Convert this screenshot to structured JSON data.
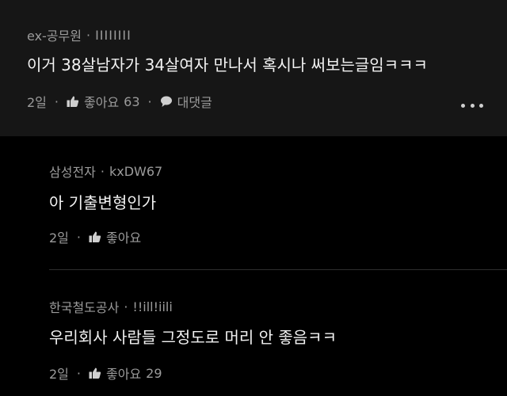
{
  "comments": [
    {
      "author": "ex-공무원",
      "handle": "IIIIIIII",
      "text": "이거 38살남자가 34살여자 만나서 혹시나 써보는글임ㅋㅋㅋ",
      "time": "2일",
      "like_label": "좋아요",
      "like_count": "63",
      "reply_label": "대댓글"
    }
  ],
  "replies": [
    {
      "author": "삼성전자",
      "handle": "kxDW67",
      "text": "아 기출변형인가",
      "time": "2일",
      "like_label": "좋아요"
    },
    {
      "author": "한국철도공사",
      "handle": "!!ill!iili",
      "text": "우리회사 사람들 그정도로 머리 안 좋음ㅋㅋ",
      "time": "2일",
      "like_label": "좋아요",
      "like_count": "29"
    }
  ],
  "icons": {
    "like": "thumbs-up-icon",
    "reply": "speech-bubble-icon",
    "more": "more-dots-icon"
  },
  "colors": {
    "background": "#000000",
    "main_comment_bg": "#161616",
    "text": "#f2f2f2",
    "meta": "#9b9b9b"
  }
}
